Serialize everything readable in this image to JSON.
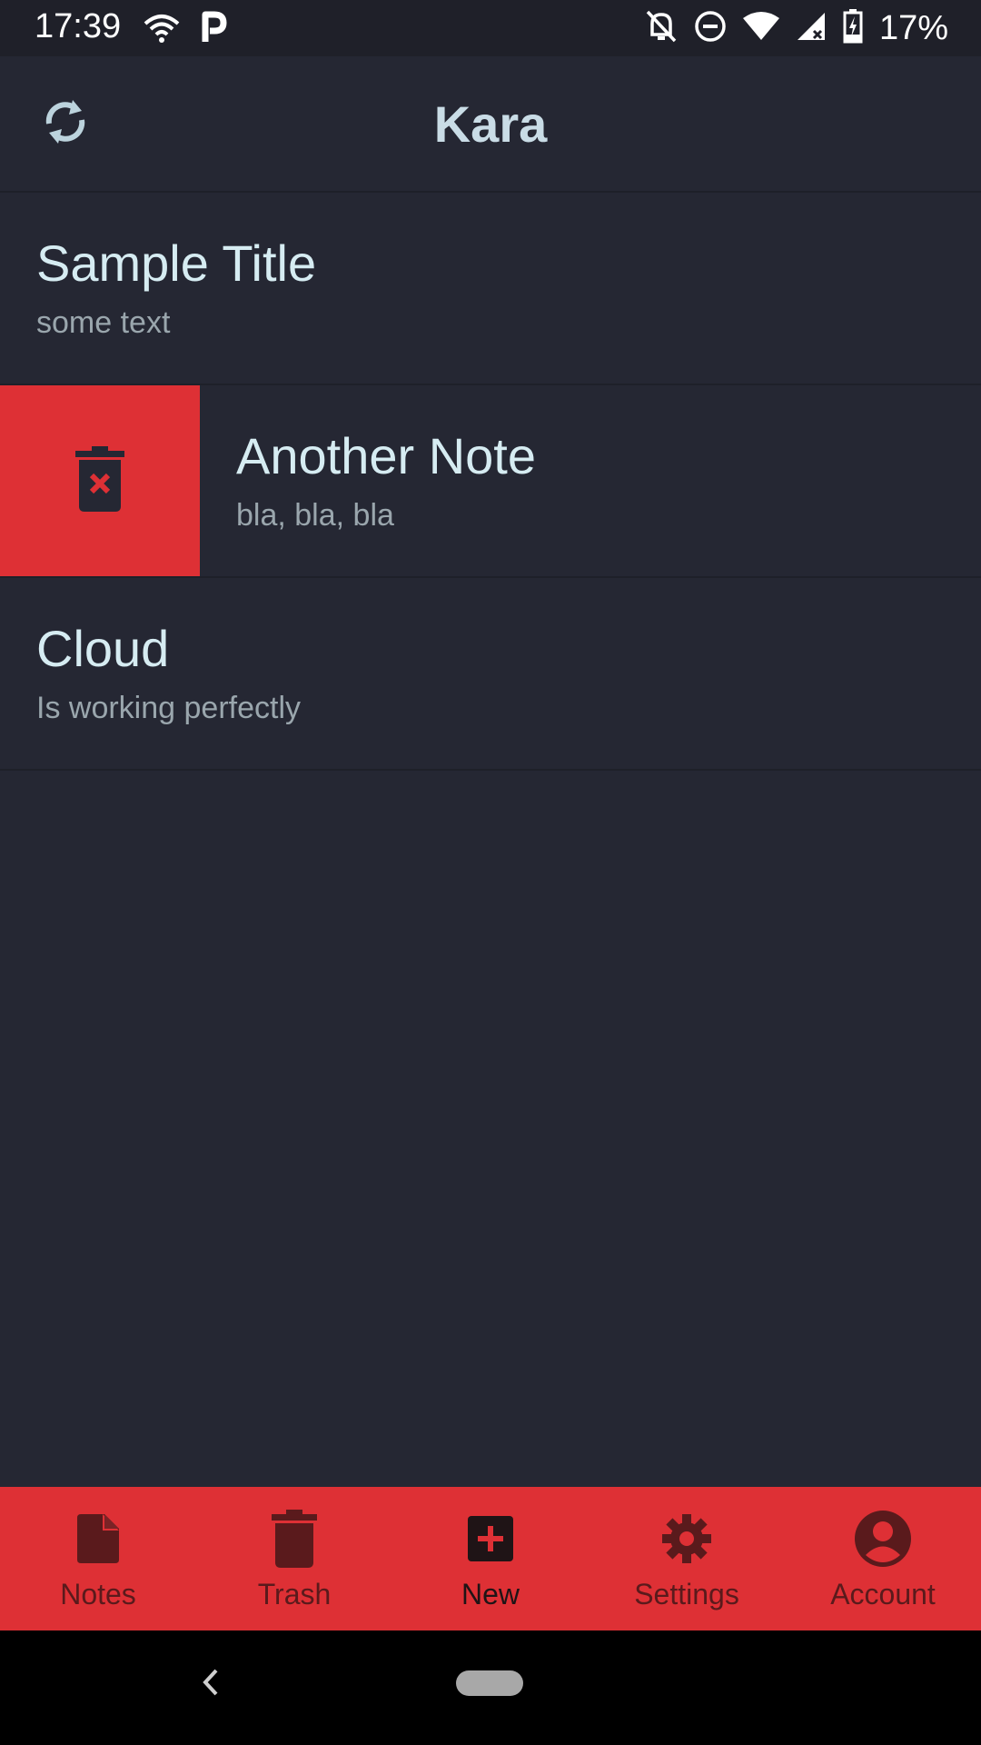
{
  "status_bar": {
    "time": "17:39",
    "battery": "17%",
    "icons": [
      "wifi-icon",
      "parking-app-icon",
      "notifications-off-icon",
      "do-not-disturb-icon",
      "wifi-signal-icon",
      "cell-signal-icon",
      "battery-charging-icon"
    ]
  },
  "app_bar": {
    "title": "Kara",
    "sync_icon": "sync-icon"
  },
  "notes": [
    {
      "title": "Sample Title",
      "body": "some text",
      "swiped": false
    },
    {
      "title": "Another Note",
      "body": "bla, bla, bla",
      "swiped": true
    },
    {
      "title": "Cloud",
      "body": "Is working perfectly",
      "swiped": false
    }
  ],
  "swipe_action": {
    "icon": "delete-icon"
  },
  "bottom_nav": {
    "items": [
      {
        "label": "Notes",
        "icon": "note-icon",
        "active": false
      },
      {
        "label": "Trash",
        "icon": "trash-icon",
        "active": false
      },
      {
        "label": "New",
        "icon": "add-icon",
        "active": true
      },
      {
        "label": "Settings",
        "icon": "gear-icon",
        "active": false
      },
      {
        "label": "Account",
        "icon": "account-icon",
        "active": false
      }
    ]
  },
  "colors": {
    "background": "#252733",
    "accent": "#de3035",
    "title_text": "#c9dce6"
  }
}
